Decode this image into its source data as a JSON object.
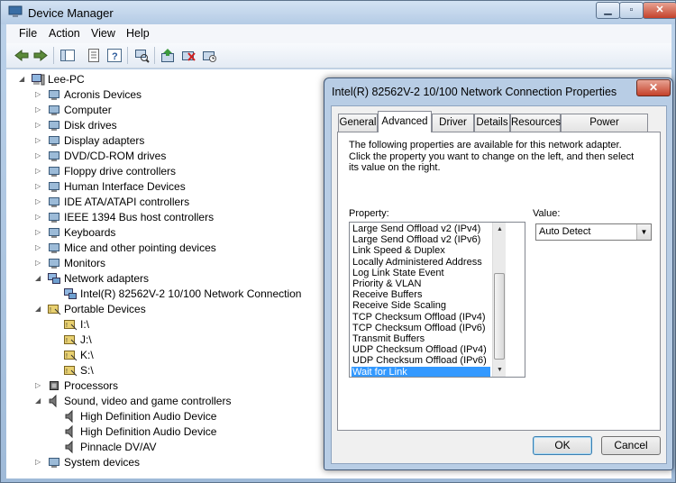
{
  "window": {
    "title": "Device Manager"
  },
  "menu": [
    "File",
    "Action",
    "View",
    "Help"
  ],
  "toolbar_icons": [
    "back-icon",
    "forward-icon",
    "show-hide-console-tree-icon",
    "properties-icon",
    "help-icon",
    "scan-hardware-icon",
    "update-driver-icon",
    "uninstall-icon",
    "disable-icon"
  ],
  "tree": {
    "root": "Lee-PC",
    "items": [
      {
        "label": "Acronis Devices",
        "expanded": false
      },
      {
        "label": "Computer",
        "expanded": false
      },
      {
        "label": "Disk drives",
        "expanded": false
      },
      {
        "label": "Display adapters",
        "expanded": false
      },
      {
        "label": "DVD/CD-ROM drives",
        "expanded": false
      },
      {
        "label": "Floppy drive controllers",
        "expanded": false
      },
      {
        "label": "Human Interface Devices",
        "expanded": false
      },
      {
        "label": "IDE ATA/ATAPI controllers",
        "expanded": false
      },
      {
        "label": "IEEE 1394 Bus host controllers",
        "expanded": false
      },
      {
        "label": "Keyboards",
        "expanded": false
      },
      {
        "label": "Mice and other pointing devices",
        "expanded": false
      },
      {
        "label": "Monitors",
        "expanded": false
      },
      {
        "label": "Network adapters",
        "expanded": true,
        "children": [
          "Intel(R) 82562V-2 10/100 Network Connection"
        ]
      },
      {
        "label": "Portable Devices",
        "expanded": true,
        "children": [
          "I:\\",
          "J:\\",
          "K:\\",
          "S:\\"
        ]
      },
      {
        "label": "Processors",
        "expanded": false
      },
      {
        "label": "Sound, video and game controllers",
        "expanded": true,
        "children": [
          "High Definition Audio Device",
          "High Definition Audio Device",
          "Pinnacle DV/AV"
        ]
      },
      {
        "label": "System devices",
        "expanded": false
      }
    ]
  },
  "dialog": {
    "title": "Intel(R) 82562V-2 10/100 Network Connection Properties",
    "tabs": [
      "General",
      "Advanced",
      "Driver",
      "Details",
      "Resources",
      "Power Management"
    ],
    "active_tab": "Advanced",
    "description": "The following properties are available for this network adapter. Click the property you want to change on the left, and then select its value on the right.",
    "property_label": "Property:",
    "value_label": "Value:",
    "properties": [
      "Large Send Offload v2 (IPv4)",
      "Large Send Offload v2 (IPv6)",
      "Link Speed & Duplex",
      "Locally Administered Address",
      "Log Link State Event",
      "Priority & VLAN",
      "Receive Buffers",
      "Receive Side Scaling",
      "TCP Checksum Offload (IPv4)",
      "TCP Checksum Offload (IPv6)",
      "Transmit Buffers",
      "UDP Checksum Offload (IPv4)",
      "UDP Checksum Offload (IPv6)",
      "Wait for Link"
    ],
    "selected_property": "Wait for Link",
    "value": "Auto Detect",
    "ok_label": "OK",
    "cancel_label": "Cancel"
  },
  "colors": {
    "selection": "#3399ff",
    "title_bar": "#b4cbe5"
  }
}
